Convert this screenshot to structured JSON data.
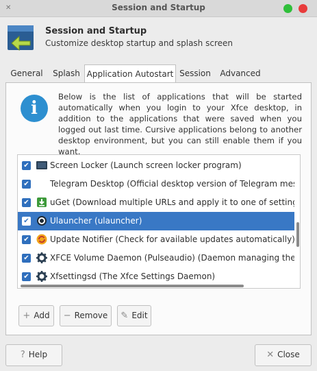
{
  "window": {
    "title": "Session and Startup"
  },
  "header": {
    "title": "Session and Startup",
    "subtitle": "Customize desktop startup and splash screen"
  },
  "tabs": [
    {
      "label": "General",
      "active": false
    },
    {
      "label": "Splash",
      "active": false
    },
    {
      "label": "Application Autostart",
      "active": true
    },
    {
      "label": "Session",
      "active": false
    },
    {
      "label": "Advanced",
      "active": false
    }
  ],
  "info": {
    "text": "Below is the list of applications that will be started automatically when you login to your Xfce desktop, in addition to the applications that were saved when you logged out last time. Cursive applications belong to another desktop environment, but you can still enable them if you want."
  },
  "autostart_list": [
    {
      "label": "Screen Locker (Launch screen locker program)",
      "checked": true,
      "icon": "screen-icon",
      "selected": false
    },
    {
      "label": "Telegram Desktop (Official desktop version of Telegram messa",
      "checked": true,
      "icon": "none",
      "selected": false
    },
    {
      "label": "uGet (Download multiple URLs and apply it to one of setting/que",
      "checked": true,
      "icon": "uget-icon",
      "selected": false
    },
    {
      "label": "Ulauncher (ulauncher)",
      "checked": true,
      "icon": "ulauncher-icon",
      "selected": true
    },
    {
      "label": "Update Notifier (Check for available updates automatically)",
      "checked": true,
      "icon": "update-icon",
      "selected": false
    },
    {
      "label": "XFCE Volume Daemon (Pulseaudio) (Daemon managing the volu",
      "checked": true,
      "icon": "gear-icon",
      "selected": false
    },
    {
      "label": "Xfsettingsd (The Xfce Settings Daemon)",
      "checked": true,
      "icon": "gear-icon",
      "selected": false
    }
  ],
  "buttons": {
    "add": "Add",
    "remove": "Remove",
    "edit": "Edit",
    "help": "Help",
    "close": "Close"
  },
  "colors": {
    "accent": "#3978c5",
    "info_icon": "#2d8fd0",
    "window_close": "#e83b3b",
    "window_maximize": "#2fbf3a"
  }
}
